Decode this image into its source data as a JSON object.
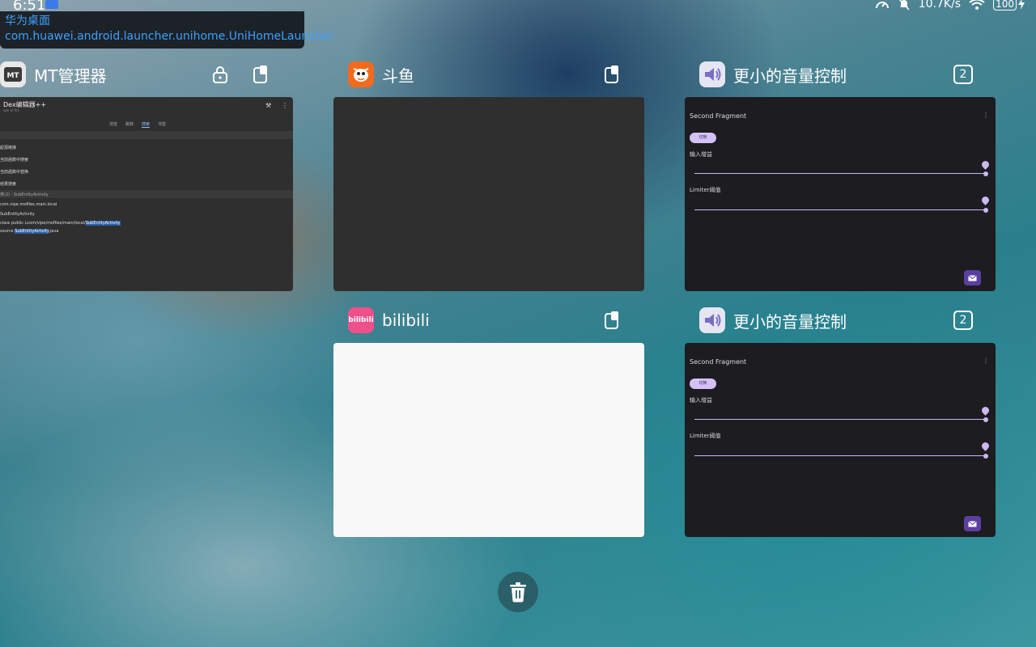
{
  "status_bar": {
    "time": "6:51",
    "network_speed": "10.7K/s",
    "battery": "100"
  },
  "tooltip": {
    "app_label": "华为桌面",
    "activity": "com.huawei.android.launcher.unihome.UniHomeLauncher"
  },
  "cards": {
    "mt": {
      "name": "MT管理器",
      "icon": "mt-manager-icon",
      "preview": {
        "title": "Dex编辑器++",
        "subtitle": "apk of file",
        "tabs": [
          "浏览",
          "跳转",
          "搜索",
          "书签"
        ],
        "lines": [
          "起源链接",
          "当前函数中搜索",
          "当前函数中替换",
          "结果搜索",
          "类(2) · SubEntityActivity",
          "com.vipe.mofilex.main.local",
          "SubEntityActivity",
          "class public Lcom/vipe/mofilex/main/local/",
          "SubEntityActivity",
          "source ",
          "SubEntityActivity",
          ".java"
        ]
      }
    },
    "douyu": {
      "name": "斗鱼",
      "icon": "douyu-icon"
    },
    "bilibili": {
      "name": "bilibili",
      "icon": "bilibili-icon",
      "icon_text": "bilibili"
    },
    "volume1": {
      "name": "更小的音量控制",
      "icon": "speaker-icon",
      "badge": "2",
      "preview": {
        "title": "Second Fragment",
        "chip": "切换",
        "input_gain_label": "输入增益",
        "limiter_label": "Limiter阈值",
        "input_gain_value": 1.0,
        "limiter_value": 1.0
      }
    },
    "volume2": {
      "name": "更小的音量控制",
      "icon": "speaker-icon",
      "badge": "2",
      "preview": {
        "title": "Second Fragment",
        "chip": "切换",
        "input_gain_label": "输入增益",
        "limiter_label": "Limiter阈值",
        "input_gain_value": 1.0,
        "limiter_value": 1.0
      }
    }
  },
  "actions": {
    "clear_all_icon": "trash-icon"
  }
}
